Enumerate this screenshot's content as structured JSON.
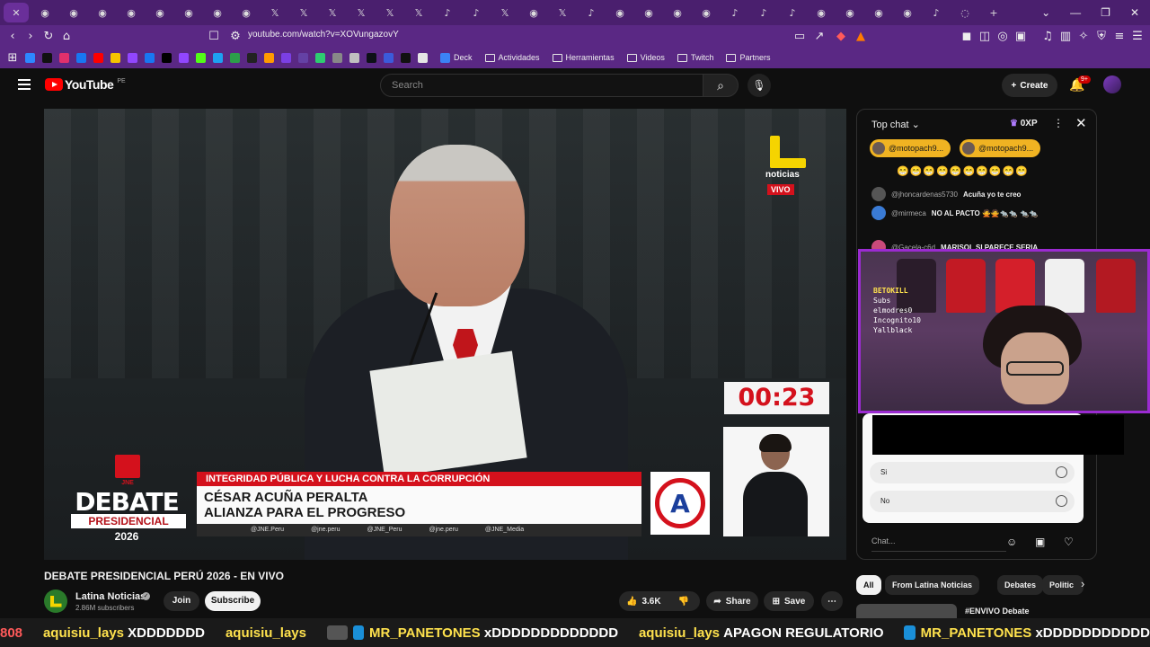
{
  "browser": {
    "url": "youtube.com/watch?v=XOVungazovY",
    "bookmarks": [
      "Deck",
      "Actividades",
      "Herramientas",
      "Videos",
      "Twitch",
      "Partners"
    ]
  },
  "header": {
    "logo": "YouTube",
    "region": "PE",
    "search_placeholder": "Search",
    "create_label": "Create",
    "notification_badge": "9+"
  },
  "video": {
    "channel_overlay": "noticias",
    "live_badge": "VIVO",
    "timer": "00:23",
    "topic": "INTEGRIDAD PÚBLICA Y LUCHA CONTRA LA CORRUPCIÓN",
    "candidate": "CÉSAR ACUÑA PERALTA",
    "party": "ALIANZA PARA EL PROGRESO",
    "socials": [
      "@JNE.Peru",
      "@jne.peru",
      "@JNE_Peru",
      "@jne.peru",
      "@JNE_Media"
    ],
    "jne": "JNE",
    "debate_word": "DEBATE",
    "presidencial_word": "PRESIDENCIAL",
    "year": "2026",
    "party_letter": "A"
  },
  "below": {
    "title": "DEBATE PRESIDENCIAL PERÚ 2026 - EN VIVO",
    "channel_name": "Latina Noticias",
    "subscribers": "2.86M subscribers",
    "join_label": "Join",
    "subscribe_label": "Subscribe",
    "likes": "3.6K",
    "share_label": "Share",
    "save_label": "Save"
  },
  "chat": {
    "title": "Top chat",
    "xp": "0XP",
    "chips": [
      "@motopach9...",
      "@motopach9..."
    ],
    "emoji_row": "😁😁😁😁😁😁😁😁😁😁",
    "messages": [
      {
        "author": "@jhoncardenas5730",
        "text": "Acuña yo te creo"
      },
      {
        "author": "@mirmeca",
        "text": "NO AL PACTO 🙅🙅🐀🐀 🐀🐀"
      },
      {
        "author": "@Gacela-c6d",
        "text": "MARISOL SI PARECE SERIA"
      }
    ],
    "poll_options": [
      "Si",
      "No"
    ],
    "input_placeholder": "Chat..."
  },
  "webcam": {
    "overlay_text": [
      "BETOKILL",
      "Subs",
      "elmodres0",
      "Incognito10",
      "Yallblack"
    ]
  },
  "related": {
    "filters": [
      "All",
      "From Latina Noticias",
      "Debates",
      "Politic"
    ],
    "first_title": "#ENVIVO Debate"
  },
  "ticker": [
    {
      "name": "",
      "text": "808"
    },
    {
      "name": "aquisiu_lays",
      "text": "XDDDDDDD"
    },
    {
      "name": "aquisiu_lays",
      "text": ""
    },
    {
      "name": "MR_PANETONES",
      "text": "xDDDDDDDDDDDDD"
    },
    {
      "name": "aquisiu_lays",
      "text": "APAGON REGULATORIO"
    },
    {
      "name": "MR_PANETONES",
      "text": "xDDDDDDDDDDD"
    }
  ],
  "colors": {
    "tabbar": "#4a1f6e",
    "toolbar": "#5a2884",
    "youtube_red": "#ff0000",
    "jne_red": "#d4111c",
    "webcam_border": "#9b2bd1",
    "chip_gold": "#f0b322"
  }
}
